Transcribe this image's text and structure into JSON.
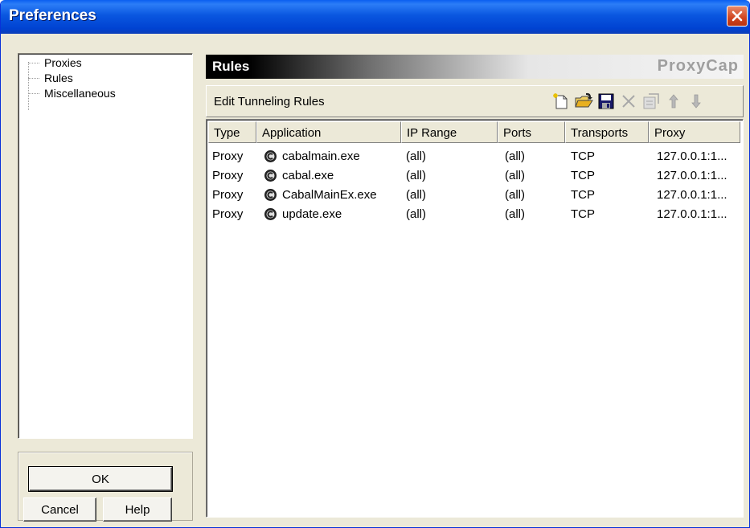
{
  "window": {
    "title": "Preferences"
  },
  "tree": {
    "items": [
      {
        "label": "Proxies"
      },
      {
        "label": "Rules"
      },
      {
        "label": "Miscellaneous"
      }
    ]
  },
  "buttons": {
    "ok": "OK",
    "cancel": "Cancel",
    "help": "Help"
  },
  "panel": {
    "title": "Rules",
    "brand": "ProxyCap"
  },
  "toolbar": {
    "label": "Edit Tunneling Rules",
    "buttons": [
      "new-rule-icon",
      "open-folder-icon",
      "save-icon",
      "delete-icon",
      "properties-icon",
      "move-up-icon",
      "move-down-icon"
    ]
  },
  "table": {
    "columns": [
      "Type",
      "Application",
      "IP Range",
      "Ports",
      "Transports",
      "Proxy"
    ],
    "rows": [
      {
        "type": "Proxy",
        "application": "cabalmain.exe",
        "ip_range": "(all)",
        "ports": "(all)",
        "transports": "TCP",
        "proxy": "127.0.0.1:1..."
      },
      {
        "type": "Proxy",
        "application": "cabal.exe",
        "ip_range": "(all)",
        "ports": "(all)",
        "transports": "TCP",
        "proxy": "127.0.0.1:1..."
      },
      {
        "type": "Proxy",
        "application": "CabalMainEx.exe",
        "ip_range": "(all)",
        "ports": "(all)",
        "transports": "TCP",
        "proxy": "127.0.0.1:1..."
      },
      {
        "type": "Proxy",
        "application": "update.exe",
        "ip_range": "(all)",
        "ports": "(all)",
        "transports": "TCP",
        "proxy": "127.0.0.1:1..."
      }
    ]
  },
  "colors": {
    "titlebar": "#0a57e0",
    "dialog_bg": "#ece9d8",
    "close_button": "#d0441e",
    "brand_text": "#9f9f9f"
  }
}
